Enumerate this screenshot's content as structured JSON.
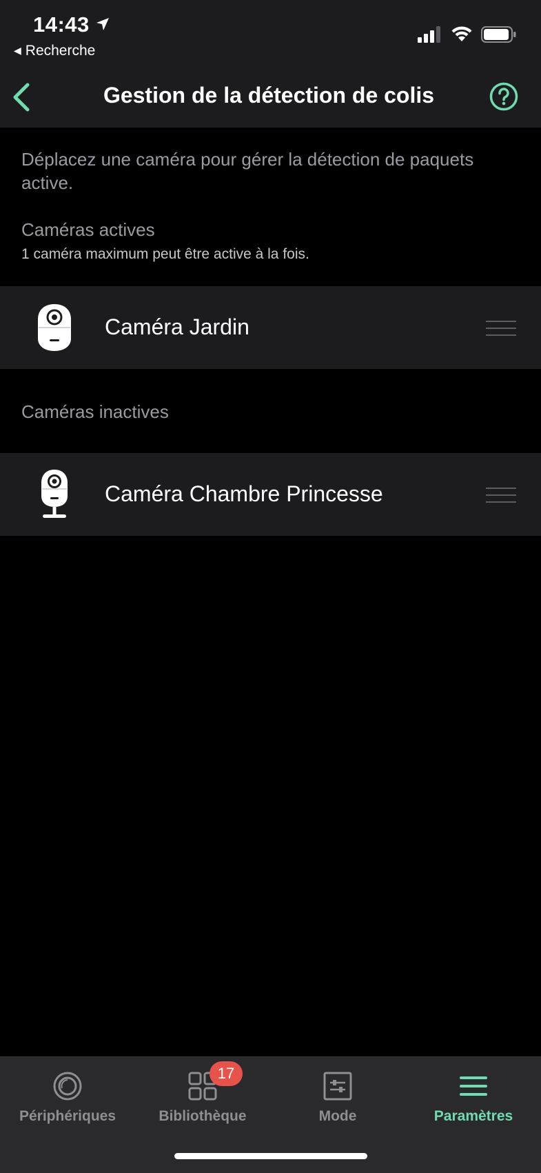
{
  "status_bar": {
    "time": "14:43",
    "back_app_label": "Recherche"
  },
  "header": {
    "title": "Gestion de la détection de colis",
    "back_icon": "chevron-left-icon",
    "help_icon": "question-circle-icon"
  },
  "description": "Déplacez une caméra pour gérer la détection de paquets active.",
  "active_section": {
    "title": "Caméras actives",
    "subtitle": "1 caméra maximum peut être active à la fois.",
    "cameras": [
      {
        "name": "Caméra Jardin",
        "icon": "outdoor-camera-icon"
      }
    ]
  },
  "inactive_section": {
    "title": "Caméras inactives",
    "cameras": [
      {
        "name": "Caméra Chambre Princesse",
        "icon": "indoor-camera-icon"
      }
    ]
  },
  "tabbar": {
    "tabs": [
      {
        "label": "Périphériques",
        "icon": "devices-icon",
        "active": false
      },
      {
        "label": "Bibliothèque",
        "icon": "library-grid-icon",
        "active": false,
        "badge": "17"
      },
      {
        "label": "Mode",
        "icon": "mode-sliders-icon",
        "active": false
      },
      {
        "label": "Paramètres",
        "icon": "menu-icon",
        "active": true
      }
    ]
  },
  "colors": {
    "accent": "#6fdcb0",
    "background": "#000000",
    "panel": "#1c1c1e",
    "badge": "#e5534b"
  }
}
